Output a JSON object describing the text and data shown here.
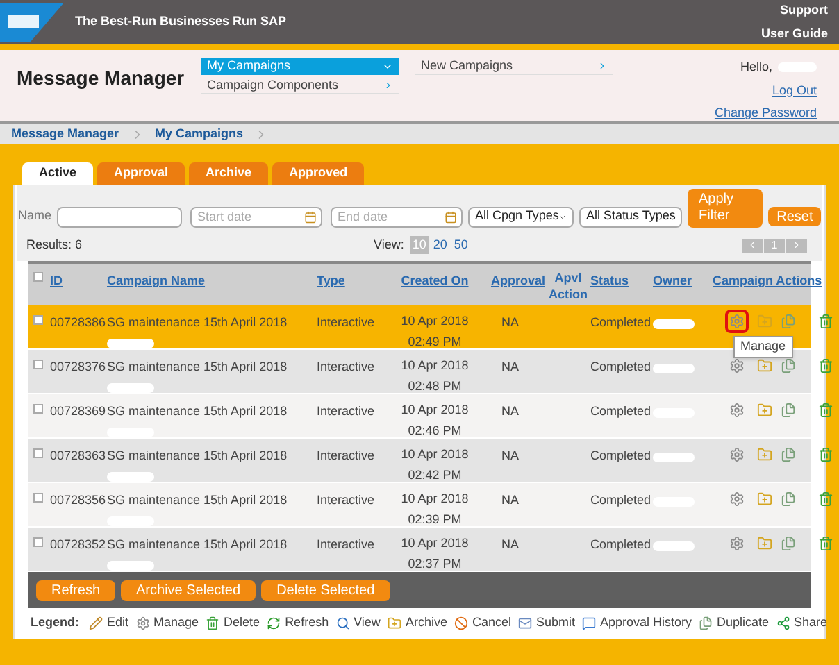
{
  "header": {
    "tagline": "The Best-Run Businesses Run SAP",
    "links": [
      "Support",
      "User Guide"
    ]
  },
  "app": {
    "title": "Message Manager",
    "greeting": "Hello,",
    "links": [
      "Log Out",
      "Change Password"
    ]
  },
  "menu": [
    {
      "label": "My Campaigns",
      "selected": true,
      "kind": "dropdown"
    },
    {
      "label": "Campaign Components",
      "selected": false,
      "kind": "submenu"
    },
    {
      "label": "New Campaigns",
      "selected": false,
      "kind": "submenu"
    }
  ],
  "breadcrumb": [
    "Message Manager",
    "My Campaigns"
  ],
  "tabs": [
    {
      "label": "Active",
      "selected": true
    },
    {
      "label": "Approval",
      "selected": false
    },
    {
      "label": "Archive",
      "selected": false
    },
    {
      "label": "Approved",
      "selected": false
    }
  ],
  "filters": {
    "name_label": "Name",
    "start_placeholder": "Start date",
    "end_placeholder": "End date",
    "type_select": "All Cpgn Types",
    "status_select": "All Status Types",
    "apply": "Apply Filter",
    "reset": "Reset"
  },
  "results": "Results: 6",
  "view": {
    "label": "View:",
    "options": [
      {
        "label": "10",
        "selected": true
      },
      {
        "label": "20",
        "selected": false
      },
      {
        "label": "50",
        "selected": false
      }
    ]
  },
  "pager": {
    "page": "1"
  },
  "table": {
    "select_all_checked": false,
    "columns": [
      "ID",
      "Campaign Name",
      "Type",
      "Created On",
      "Approval",
      "Apvl Action",
      "Status",
      "Owner",
      "Campaign Actions"
    ],
    "rows": [
      {
        "selected": true,
        "checked": false,
        "id": "00728386",
        "name": "SG maintenance 15th April 2018",
        "type": "Interactive",
        "created": "10 Apr 2018 02:49 PM",
        "approval": "NA",
        "status": "Completed",
        "highlighted_action": true,
        "tooltip": "Manage"
      },
      {
        "selected": false,
        "checked": false,
        "id": "00728376",
        "name": "SG maintenance 15th April 2018",
        "type": "Interactive",
        "created": "10 Apr 2018 02:48 PM",
        "approval": "NA",
        "status": "Completed",
        "highlighted_action": false
      },
      {
        "selected": false,
        "checked": false,
        "id": "00728369",
        "name": "SG maintenance 15th April 2018",
        "type": "Interactive",
        "created": "10 Apr 2018 02:46 PM",
        "approval": "NA",
        "status": "Completed",
        "highlighted_action": false
      },
      {
        "selected": false,
        "checked": false,
        "id": "00728363",
        "name": "SG maintenance 15th April 2018",
        "type": "Interactive",
        "created": "10 Apr 2018 02:42 PM",
        "approval": "NA",
        "status": "Completed",
        "highlighted_action": false
      },
      {
        "selected": false,
        "checked": false,
        "id": "00728356",
        "name": "SG maintenance 15th April 2018",
        "type": "Interactive",
        "created": "10 Apr 2018 02:39 PM",
        "approval": "NA",
        "status": "Completed",
        "highlighted_action": false
      },
      {
        "selected": false,
        "checked": false,
        "id": "00728352",
        "name": "SG maintenance 15th April 2018",
        "type": "Interactive",
        "created": "10 Apr 2018 02:37 PM",
        "approval": "NA",
        "status": "Completed",
        "highlighted_action": false
      }
    ]
  },
  "buttons": [
    "Refresh",
    "Archive Selected",
    "Delete Selected"
  ],
  "legend": {
    "title": "Legend:",
    "items": [
      {
        "kind": "edit",
        "label": "Edit"
      },
      {
        "kind": "manage",
        "label": "Manage"
      },
      {
        "kind": "delete",
        "label": "Delete"
      },
      {
        "kind": "refresh",
        "label": "Refresh"
      },
      {
        "kind": "view",
        "label": "View"
      },
      {
        "kind": "archive",
        "label": "Archive"
      },
      {
        "kind": "cancel",
        "label": "Cancel"
      },
      {
        "kind": "submit",
        "label": "Submit"
      },
      {
        "kind": "approval",
        "label": "Approval History"
      },
      {
        "kind": "duplicate",
        "label": "Duplicate"
      },
      {
        "kind": "share",
        "label": "Share"
      }
    ]
  }
}
